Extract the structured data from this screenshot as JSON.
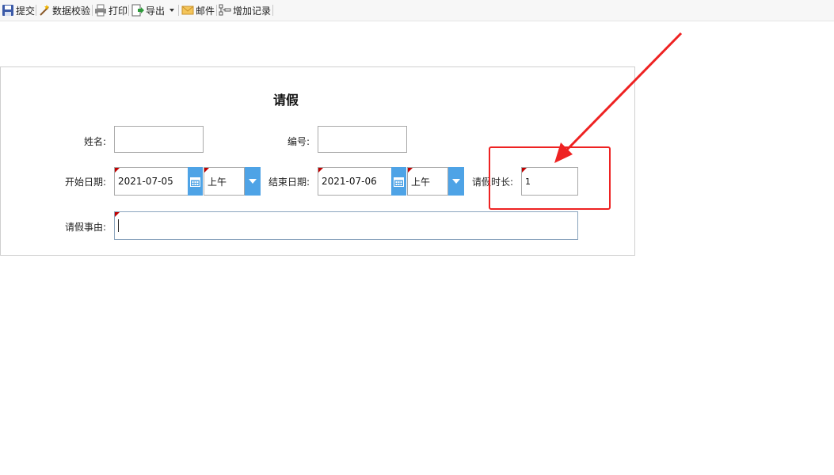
{
  "toolbar": {
    "submit": "提交",
    "validate": "数据校验",
    "print": "打印",
    "export": "导出",
    "mail": "邮件",
    "add_record": "增加记录"
  },
  "form": {
    "title": "请假",
    "name_label": "姓名:",
    "name_value": "",
    "number_label": "编号:",
    "number_value": "",
    "start_label": "开始日期:",
    "start_date": "2021-07-05",
    "start_period": "上午",
    "end_label": "结束日期:",
    "end_date": "2021-07-06",
    "end_period": "上午",
    "duration_label": "请假时长:",
    "duration_value": "1",
    "reason_label": "请假事由:",
    "reason_value": ""
  },
  "colors": {
    "accent": "#4ea3e6",
    "required_marker": "#c00000",
    "annotation": "#ee2222"
  }
}
